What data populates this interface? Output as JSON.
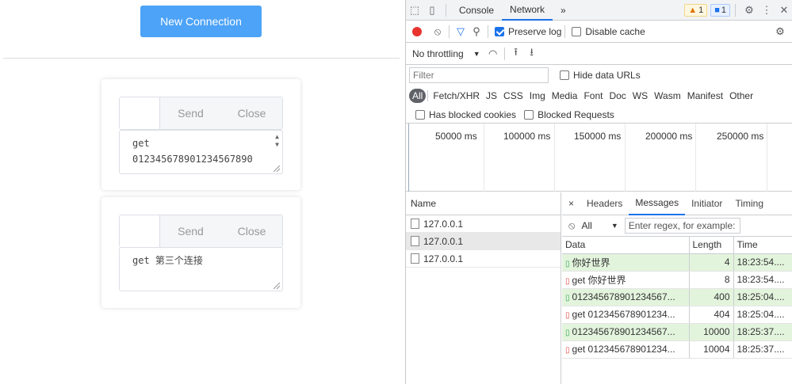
{
  "app": {
    "new_connection_label": "New Connection",
    "cards": [
      {
        "send_label": "Send",
        "close_label": "Close",
        "message_text": "get\n012345678901234567890"
      },
      {
        "send_label": "Send",
        "close_label": "Close",
        "message_text": "get 第三个连接"
      }
    ]
  },
  "devtools": {
    "tabs": {
      "console": "Console",
      "network": "Network",
      "more": "»"
    },
    "warn_count": "1",
    "msg_count": "1",
    "toolbar": {
      "preserve_log": "Preserve log",
      "disable_cache": "Disable cache"
    },
    "throttle": {
      "label": "No throttling"
    },
    "filter": {
      "placeholder": "Filter",
      "hide_data_urls": "Hide data URLs"
    },
    "types": [
      "All",
      "Fetch/XHR",
      "JS",
      "CSS",
      "Img",
      "Media",
      "Font",
      "Doc",
      "WS",
      "Wasm",
      "Manifest",
      "Other"
    ],
    "blocked": {
      "has_blocked_cookies": "Has blocked cookies",
      "blocked_requests": "Blocked Requests"
    },
    "timeline_labels": [
      "50000 ms",
      "100000 ms",
      "150000 ms",
      "200000 ms",
      "250000 ms"
    ],
    "requests": {
      "header": "Name",
      "rows": [
        "127.0.0.1",
        "127.0.0.1",
        "127.0.0.1"
      ]
    },
    "detail_tabs": [
      "×",
      "Headers",
      "Messages",
      "Initiator",
      "Timing"
    ],
    "message_filter": {
      "select_value": "All",
      "regex_placeholder": "Enter regex, for example:"
    },
    "messages": {
      "columns": [
        "Data",
        "Length",
        "Time"
      ],
      "rows": [
        {
          "dir": "up",
          "data": "你好世界",
          "length": "4",
          "time": "18:23:54...."
        },
        {
          "dir": "down",
          "data": "get 你好世界",
          "length": "8",
          "time": "18:23:54...."
        },
        {
          "dir": "up",
          "data": "012345678901234567...",
          "length": "400",
          "time": "18:25:04...."
        },
        {
          "dir": "down",
          "data": "get 012345678901234...",
          "length": "404",
          "time": "18:25:04...."
        },
        {
          "dir": "up",
          "data": "012345678901234567...",
          "length": "10000",
          "time": "18:25:37...."
        },
        {
          "dir": "down",
          "data": "get 012345678901234...",
          "length": "10004",
          "time": "18:25:37...."
        }
      ]
    }
  }
}
